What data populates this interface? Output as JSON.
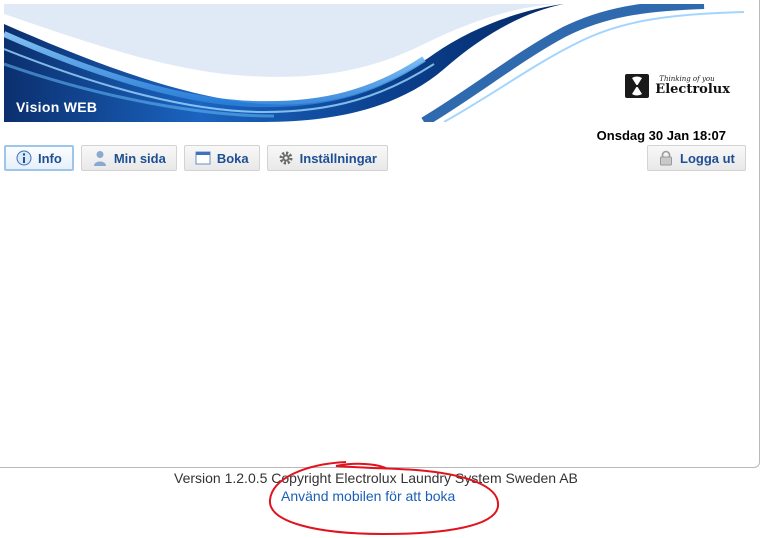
{
  "header": {
    "app_title": "Vision WEB",
    "logo_tagline": "Thinking of you",
    "logo_text": "Electrolux"
  },
  "datetime": "Onsdag 30 Jan 18:07",
  "nav": [
    {
      "label": "Info",
      "icon": "info-icon",
      "active": true
    },
    {
      "label": "Min sida",
      "icon": "person-icon"
    },
    {
      "label": "Boka",
      "icon": "calendar-icon"
    },
    {
      "label": "Inställningar",
      "icon": "gear-icon"
    }
  ],
  "logout_label": "Logga ut",
  "footer": {
    "version": "Version 1.2.0.5 Copyright Electrolux Laundry System Sweden AB",
    "mobile_link": "Använd mobilen för att boka"
  },
  "colors": {
    "nav_text": "#1e4f93",
    "banner_blue": "#0a4fa0",
    "link": "#1a5fb4",
    "annotation": "#e0141e"
  }
}
